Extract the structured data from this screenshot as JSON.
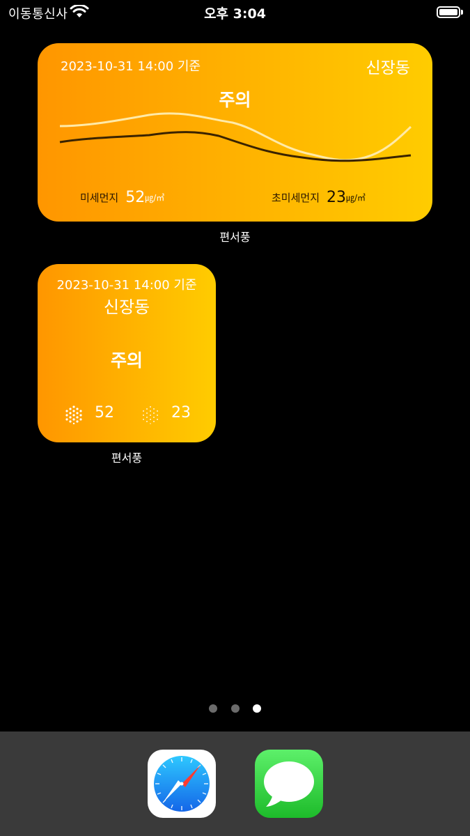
{
  "status_bar": {
    "carrier": "이동통신사",
    "time": "오후 3:04",
    "battery_level": 1.0
  },
  "widget_large": {
    "timestamp": "2023-10-31 14:00 기준",
    "location": "신장동",
    "status": "주의",
    "pm10": {
      "label": "미세먼지",
      "value": "52",
      "unit": "㎍/㎥"
    },
    "pm25": {
      "label": "초미세먼지",
      "value": "23",
      "unit": "㎍/㎥"
    },
    "app_label": "편서풍",
    "colors": {
      "pm10_line": "#ffe9a6",
      "pm25_line": "#3a2300"
    }
  },
  "widget_small": {
    "timestamp": "2023-10-31 14:00 기준",
    "location": "신장동",
    "status": "주의",
    "pm10_value": "52",
    "pm25_value": "23",
    "pm10_icon": "dense-dots-icon",
    "pm25_icon": "sparse-dots-icon",
    "app_label": "편서풍"
  },
  "page_indicator": {
    "count": 3,
    "active": 3
  },
  "dock": {
    "apps": [
      {
        "name": "Safari",
        "icon": "safari-compass-icon"
      },
      {
        "name": "Messages",
        "icon": "messages-bubble-icon"
      }
    ]
  },
  "colors": {
    "widget_gradient_start": "#ff9600",
    "widget_gradient_end": "#ffcc00",
    "dock_bg": "#3a3a3a"
  }
}
